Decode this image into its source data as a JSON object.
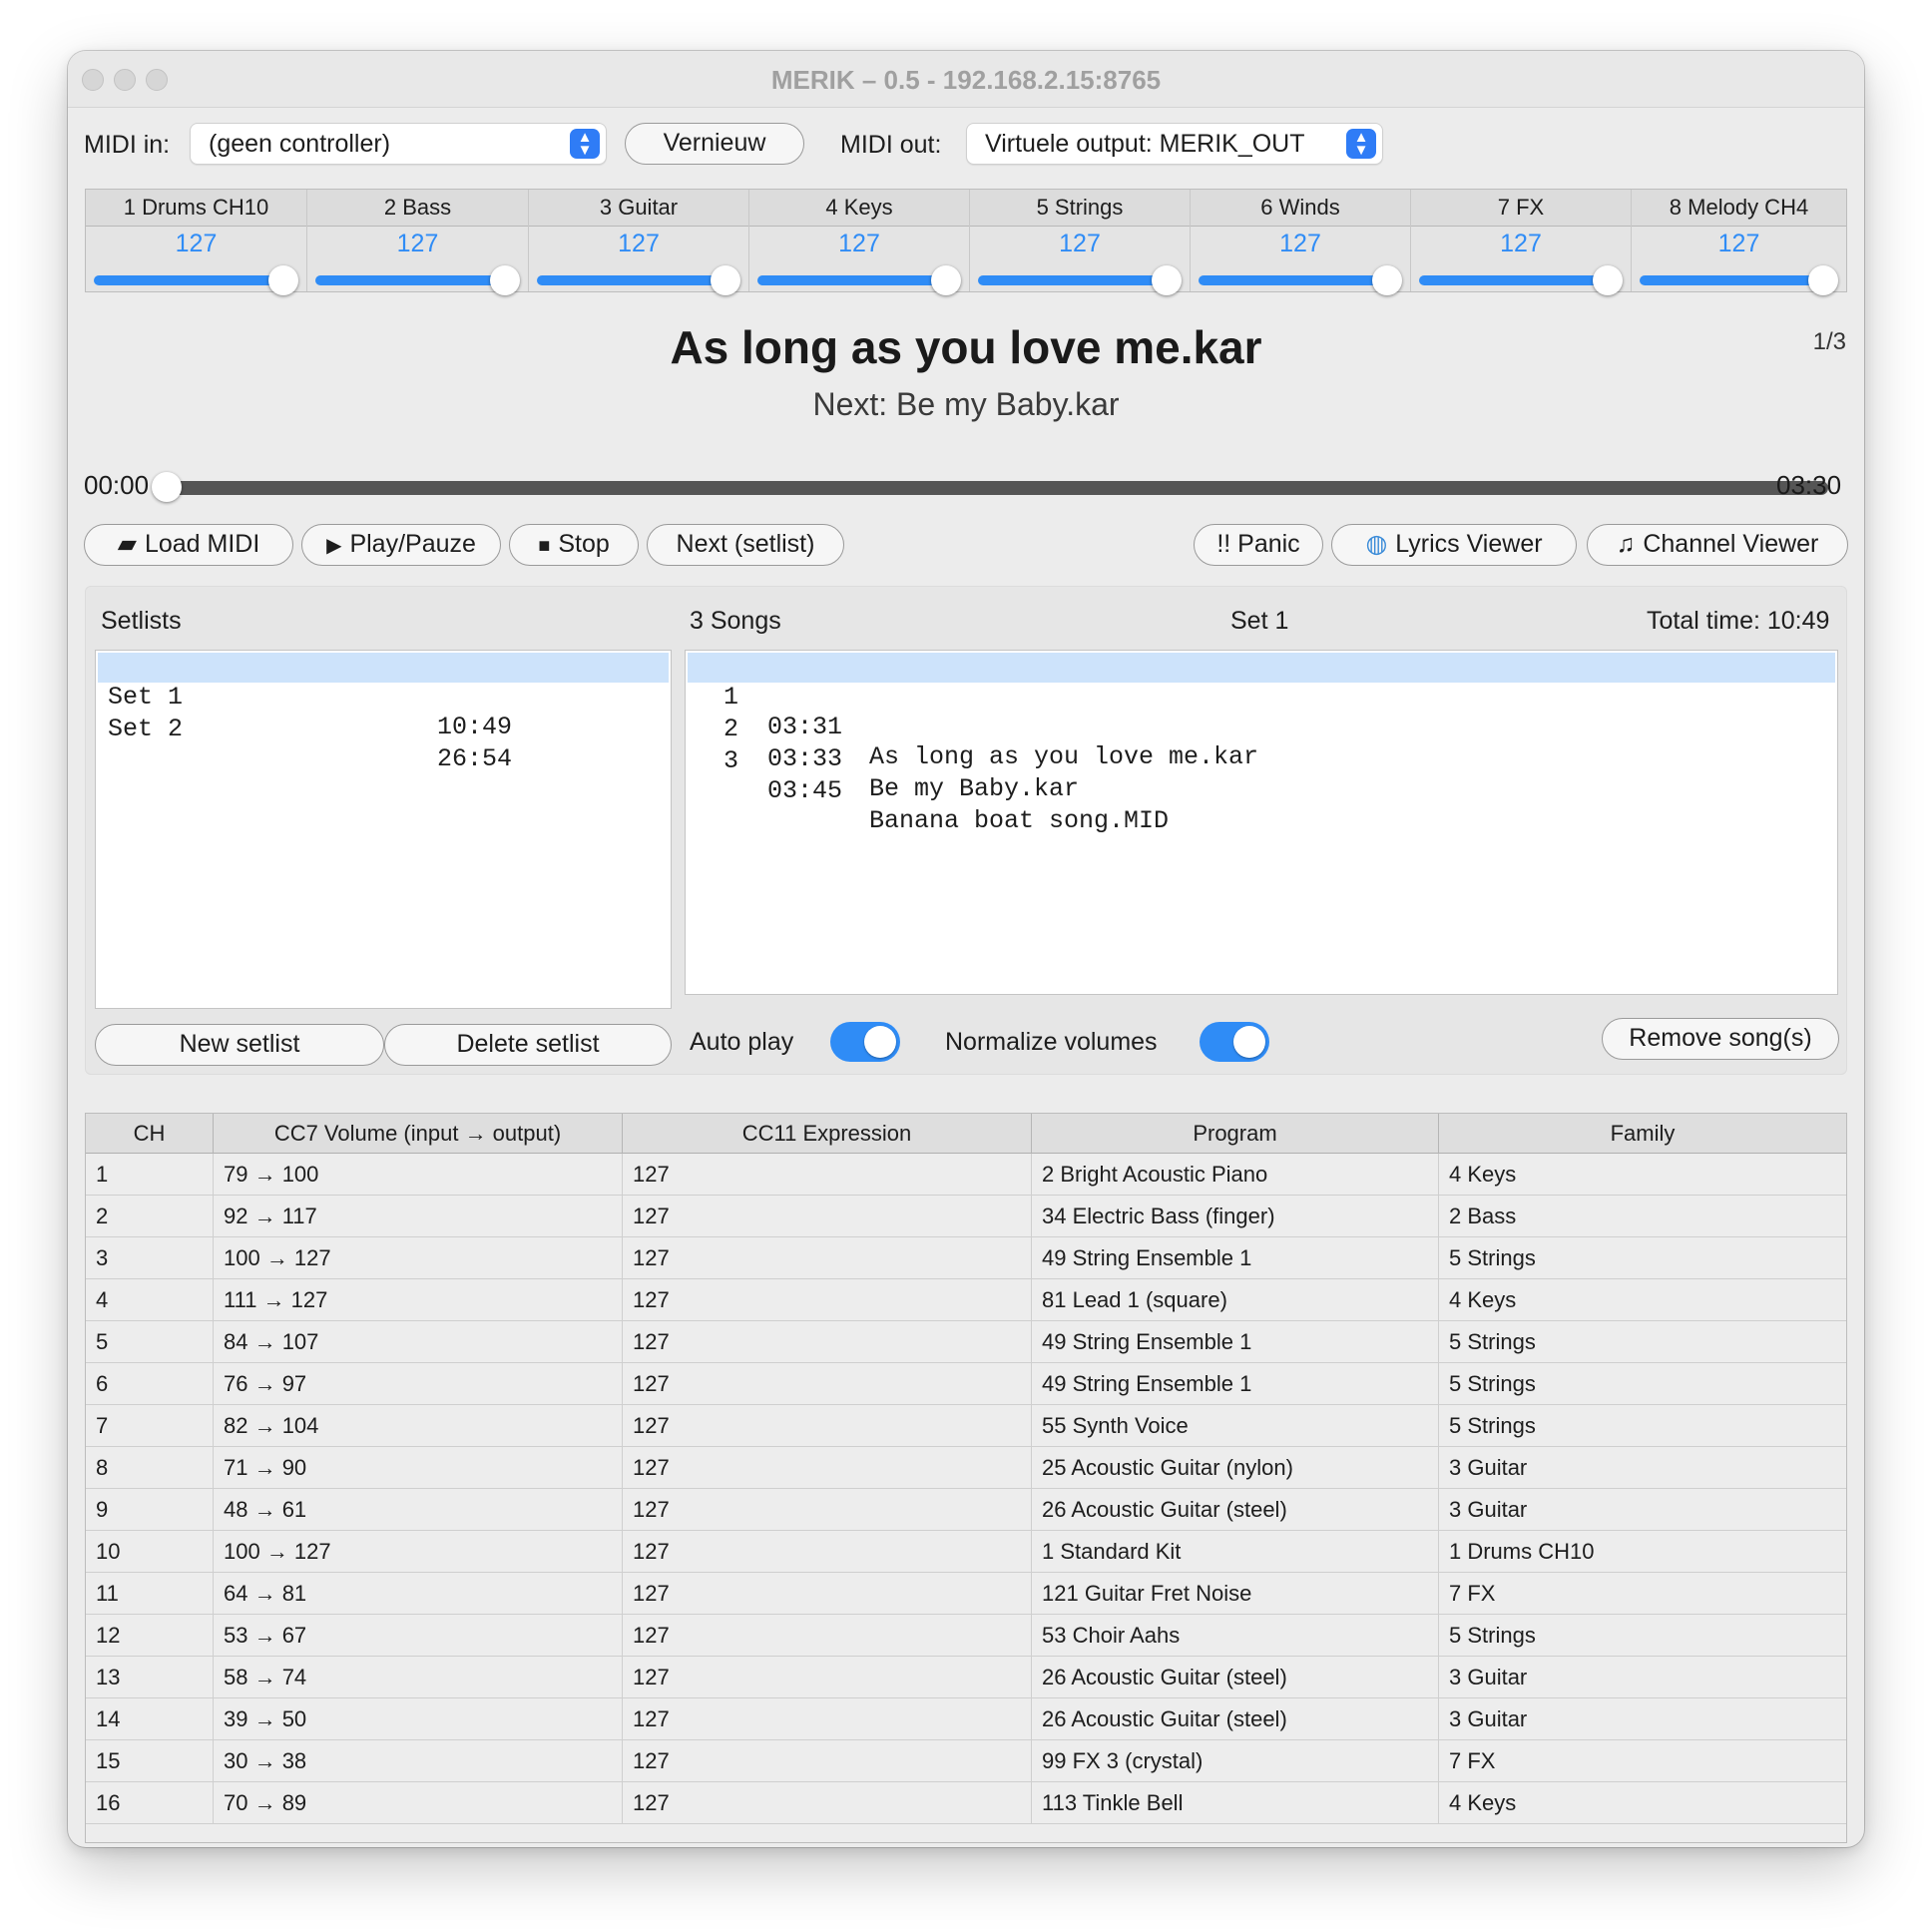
{
  "window": {
    "title": "MERIK – 0.5 - 192.168.2.15:8765"
  },
  "midi": {
    "in_label": "MIDI in:",
    "in_value": "(geen controller)",
    "refresh_label": "Vernieuw",
    "out_label": "MIDI out:",
    "out_value": "Virtuele output: MERIK_OUT"
  },
  "mixer": {
    "channels": [
      {
        "name": "1 Drums CH10",
        "value": "127",
        "level": 127
      },
      {
        "name": "2 Bass",
        "value": "127",
        "level": 127
      },
      {
        "name": "3 Guitar",
        "value": "127",
        "level": 127
      },
      {
        "name": "4 Keys",
        "value": "127",
        "level": 127
      },
      {
        "name": "5 Strings",
        "value": "127",
        "level": 127
      },
      {
        "name": "6 Winds",
        "value": "127",
        "level": 127
      },
      {
        "name": "7 FX",
        "value": "127",
        "level": 127
      },
      {
        "name": "8 Melody CH4",
        "value": "127",
        "level": 127
      }
    ]
  },
  "player": {
    "current_song": "As long as you love me.kar",
    "next_song": "Next: Be my Baby.kar",
    "position_indicator": "1/3",
    "elapsed": "00:00",
    "duration": "03:30",
    "progress": 0
  },
  "toolbar": {
    "load_label": "Load MIDI",
    "play_label": "Play/Pauze",
    "stop_label": "Stop",
    "next_label": "Next (setlist)",
    "panic_label": "!! Panic",
    "lyrics_label": "Lyrics Viewer",
    "channel_label": "Channel Viewer",
    "icons": {
      "load": "folder-icon",
      "play": "play-icon",
      "stop": "stop-icon",
      "lyrics": "globe-icon",
      "channel": "music-note-icon"
    }
  },
  "setlists": {
    "header": "Setlists",
    "items": [
      {
        "name": "Set 1",
        "time": "10:49",
        "selected": true
      },
      {
        "name": "Set 2",
        "time": "26:54",
        "selected": false
      }
    ],
    "new_label": "New setlist",
    "delete_label": "Delete setlist"
  },
  "songs": {
    "count_label": "3 Songs",
    "set_name": "Set 1",
    "total_time": "Total time: 10:49",
    "items": [
      {
        "index": "1",
        "time": "03:31",
        "title": "As long as you love me.kar",
        "selected": true
      },
      {
        "index": "2",
        "time": "03:33",
        "title": "Be my Baby.kar",
        "selected": false
      },
      {
        "index": "3",
        "time": "03:45",
        "title": "Banana boat song.MID",
        "selected": false
      }
    ],
    "auto_play_label": "Auto play",
    "auto_play_on": true,
    "normalize_label": "Normalize volumes",
    "normalize_on": true,
    "remove_label": "Remove song(s)"
  },
  "channels_table": {
    "headers": [
      "CH",
      "CC7 Volume (input → output)",
      "CC11 Expression",
      "Program",
      "Family"
    ],
    "rows": [
      [
        "1",
        "79 → 100",
        "127",
        "2 Bright Acoustic Piano",
        "4 Keys"
      ],
      [
        "2",
        "92 → 117",
        "127",
        "34 Electric Bass (finger)",
        "2 Bass"
      ],
      [
        "3",
        "100 → 127",
        "127",
        "49 String Ensemble 1",
        "5 Strings"
      ],
      [
        "4",
        "111 → 127",
        "127",
        "81 Lead 1 (square)",
        "4 Keys"
      ],
      [
        "5",
        "84 → 107",
        "127",
        "49 String Ensemble 1",
        "5 Strings"
      ],
      [
        "6",
        "76 → 97",
        "127",
        "49 String Ensemble 1",
        "5 Strings"
      ],
      [
        "7",
        "82 → 104",
        "127",
        "55 Synth Voice",
        "5 Strings"
      ],
      [
        "8",
        "71 → 90",
        "127",
        "25 Acoustic Guitar (nylon)",
        "3 Guitar"
      ],
      [
        "9",
        "48 → 61",
        "127",
        "26 Acoustic Guitar (steel)",
        "3 Guitar"
      ],
      [
        "10",
        "100 → 127",
        "127",
        "1 Standard Kit",
        "1 Drums CH10"
      ],
      [
        "11",
        "64 → 81",
        "127",
        "121 Guitar Fret Noise",
        "7 FX"
      ],
      [
        "12",
        "53 → 67",
        "127",
        "53 Choir Aahs",
        "5 Strings"
      ],
      [
        "13",
        "58 → 74",
        "127",
        "26 Acoustic Guitar (steel)",
        "3 Guitar"
      ],
      [
        "14",
        "39 → 50",
        "127",
        "26 Acoustic Guitar (steel)",
        "3 Guitar"
      ],
      [
        "15",
        "30 → 38",
        "127",
        "99 FX 3 (crystal)",
        "7 FX"
      ],
      [
        "16",
        "70 → 89",
        "127",
        "113 Tinkle Bell",
        "4 Keys"
      ]
    ]
  }
}
